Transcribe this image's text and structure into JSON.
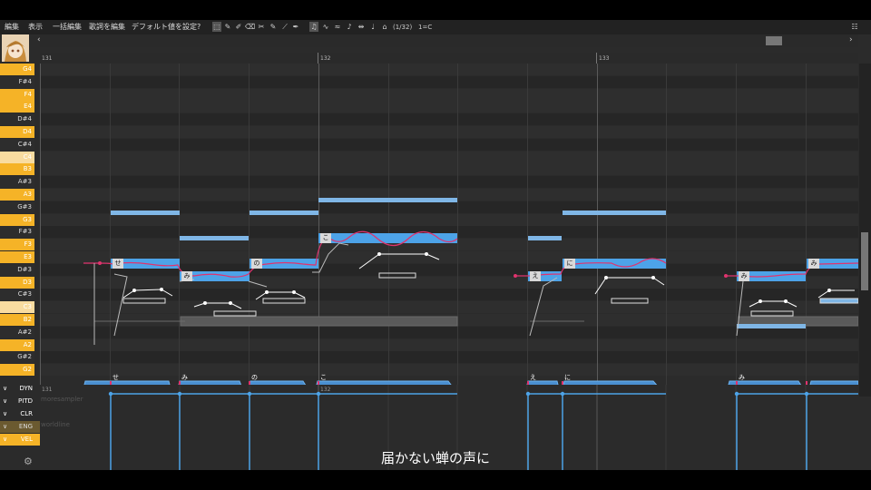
{
  "menu": {
    "edit": "編集",
    "view": "表示",
    "batch_edit": "一括編集",
    "lyrics_edit": "歌詞を編集",
    "set_default": "デフォルト値を設定",
    "help": "?"
  },
  "status": {
    "quantize": "(1/32)",
    "key": "1=C"
  },
  "ruler": {
    "bar1": "131",
    "bar2": "132",
    "bar3": "133"
  },
  "piano_keys": [
    {
      "label": "G4",
      "kind": "white"
    },
    {
      "label": "F#4",
      "kind": "black"
    },
    {
      "label": "F4",
      "kind": "white"
    },
    {
      "label": "E4",
      "kind": "white"
    },
    {
      "label": "D#4",
      "kind": "black"
    },
    {
      "label": "D4",
      "kind": "white"
    },
    {
      "label": "C#4",
      "kind": "black"
    },
    {
      "label": "C4",
      "kind": "cr"
    },
    {
      "label": "B3",
      "kind": "white"
    },
    {
      "label": "A#3",
      "kind": "black"
    },
    {
      "label": "A3",
      "kind": "white"
    },
    {
      "label": "G#3",
      "kind": "black"
    },
    {
      "label": "G3",
      "kind": "white"
    },
    {
      "label": "F#3",
      "kind": "black"
    },
    {
      "label": "F3",
      "kind": "white"
    },
    {
      "label": "E3",
      "kind": "white"
    },
    {
      "label": "D#3",
      "kind": "black"
    },
    {
      "label": "D3",
      "kind": "white"
    },
    {
      "label": "C#3",
      "kind": "black"
    },
    {
      "label": "C3",
      "kind": "cr"
    },
    {
      "label": "B2",
      "kind": "white"
    },
    {
      "label": "A#2",
      "kind": "black"
    },
    {
      "label": "A2",
      "kind": "white"
    },
    {
      "label": "G#2",
      "kind": "black"
    },
    {
      "label": "G2",
      "kind": "white"
    }
  ],
  "lyrics": [
    "せ",
    "み",
    "の",
    "こ",
    "え",
    "に",
    "み"
  ],
  "expressions": [
    {
      "label": "DYN",
      "state": "off"
    },
    {
      "label": "PITD",
      "state": "off"
    },
    {
      "label": "CLR",
      "state": "off"
    },
    {
      "label": "ENG",
      "state": "dim"
    },
    {
      "label": "VEL",
      "state": "on"
    }
  ],
  "expression_tracks": {
    "resampler": "moresampler",
    "wavtool": "worldline",
    "bar1": "131",
    "bar2": "132"
  },
  "subtitle": "届かない蝉の声に",
  "colors": {
    "accent": "#f5b327",
    "note_selected": "#4da3e8",
    "note_plain": "#7fb6e6",
    "pitch_curve": "#e0336e"
  }
}
